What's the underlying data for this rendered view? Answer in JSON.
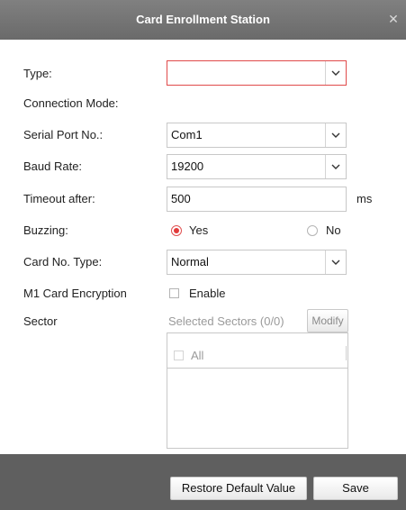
{
  "dialog": {
    "title": "Card Enrollment Station",
    "close_icon": "close-icon"
  },
  "form": {
    "type_label": "Type:",
    "type_value": "",
    "connection_mode_label": "Connection Mode:",
    "serial_port_label": "Serial Port No.:",
    "serial_port_value": "Com1",
    "baud_rate_label": "Baud Rate:",
    "baud_rate_value": "19200",
    "timeout_label": "Timeout after:",
    "timeout_value": "500",
    "timeout_unit": "ms",
    "buzzing_label": "Buzzing:",
    "buzzing_yes": "Yes",
    "buzzing_no": "No",
    "buzzing_selected": "Yes",
    "card_no_type_label": "Card No. Type:",
    "card_no_type_value": "Normal",
    "m1_label": "M1 Card Encryption",
    "enable_label": "Enable",
    "enable_checked": false,
    "sector_label": "Sector",
    "selected_sectors": "Selected Sectors (0/0)",
    "modify_label": "Modify",
    "all_label": "All"
  },
  "footer": {
    "restore_label": "Restore Default Value",
    "save_label": "Save"
  },
  "colors": {
    "titlebar": "#7a7a7a",
    "accent_red": "#e23b3b",
    "footer": "#5f5f5f"
  }
}
